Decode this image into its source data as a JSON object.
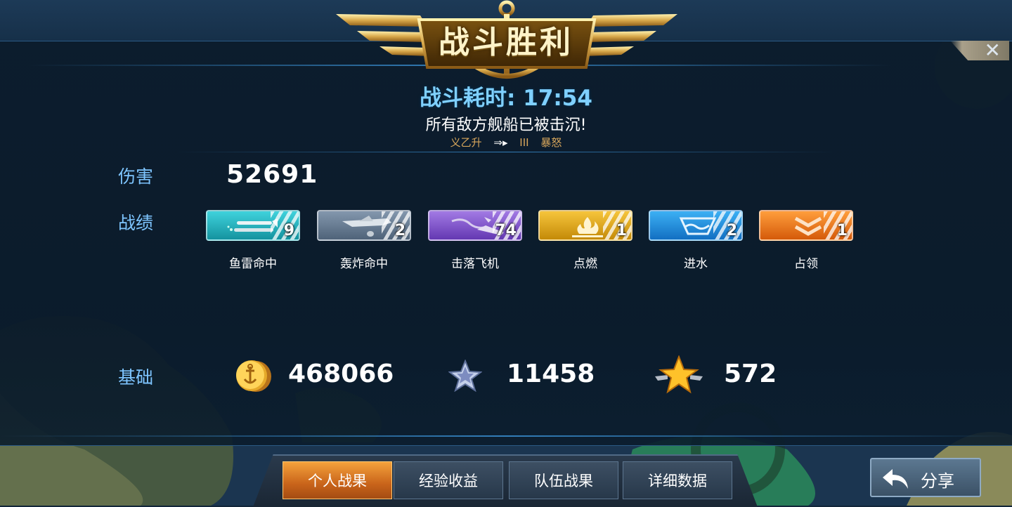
{
  "header": {
    "title": "战斗胜利",
    "battle_time": "战斗耗时: 17:54",
    "subtitle": "所有敌方舰船已被击沉!",
    "tagline_left": "义乙升",
    "tagline_arrow": "⇒▸",
    "tagline_mid": "III",
    "tagline_right": "暴怒"
  },
  "close": {
    "icon": "close-icon",
    "symbol": "✕"
  },
  "damage": {
    "label": "伤害",
    "value": "52691"
  },
  "record": {
    "label": "战绩",
    "items": [
      {
        "name": "鱼雷命中",
        "count": "9",
        "icon": "torpedo-icon",
        "color": "#1fb6c4"
      },
      {
        "name": "轰炸命中",
        "count": "2",
        "icon": "bomber-icon",
        "color": "#5e738c"
      },
      {
        "name": "击落飞机",
        "count": "74",
        "icon": "plane-shot-icon",
        "color": "#7a4fc4"
      },
      {
        "name": "点燃",
        "count": "1",
        "icon": "fire-icon",
        "color": "#e3a313"
      },
      {
        "name": "进水",
        "count": "2",
        "icon": "flood-icon",
        "color": "#1c8fe0"
      },
      {
        "name": "占领",
        "count": "1",
        "icon": "capture-icon",
        "color": "#ef7a16"
      }
    ]
  },
  "base": {
    "label": "基础",
    "coins": "468066",
    "exp": "11458",
    "rank_points": "572"
  },
  "tabs": [
    "个人战果",
    "经验收益",
    "队伍战果",
    "详细数据"
  ],
  "active_tab": 0,
  "share": {
    "label": "分享",
    "icon": "share-arrow-icon"
  }
}
